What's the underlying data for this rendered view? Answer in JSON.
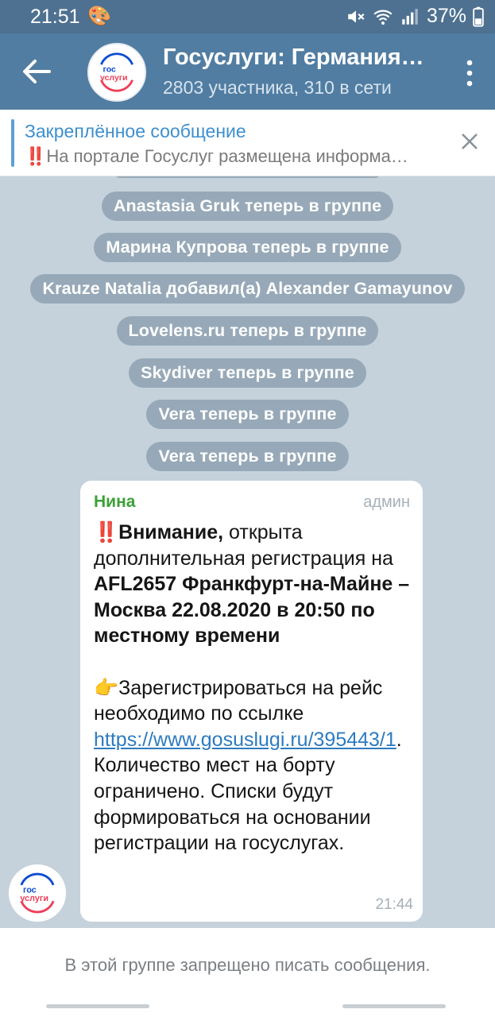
{
  "status_bar": {
    "time": "21:51",
    "battery": "37%",
    "icons": [
      "palette-icon",
      "mute-icon",
      "wifi-icon",
      "signal-icon",
      "battery-icon"
    ]
  },
  "header": {
    "title": "Госуслуги: Германия…",
    "subtitle": "2803 участника, 310 в сети",
    "avatar_text_top": "гос",
    "avatar_text_bottom": "услуги"
  },
  "pinned": {
    "title": "Закреплённое сообщение",
    "text": "‼️На портале Госуслуг размещена информа…"
  },
  "service_messages": [
    "Anastasia Gruk теперь в группе",
    "Марина Купрова теперь в группе",
    "Krauze Natalia добавил(а) Alexander Gamayunov",
    "Lovelens.ru теперь в группе",
    "Skydiver теперь в группе",
    "Vera теперь в группе",
    "Vera теперь в группе"
  ],
  "message": {
    "sender": "Нина",
    "role": "админ",
    "emoji1": "‼️",
    "bold1": "Внимание,",
    "text1": " открыта дополнительная регистрация на ",
    "bold2": "AFL2657 Франкфурт-на-Майне – Москва 22.08.2020  в 20:50 по местному времени",
    "emoji2": "👉",
    "text2": "Зарегистрироваться на рейс необходимо по ссылке ",
    "link": "https://www.gosuslugi.ru/395443/1",
    "text3": ". Количество мест на борту ограничено. Списки будут формироваться на основании регистрации на госуслугах.",
    "time": "21:44"
  },
  "footer": {
    "note": "В этой группе запрещено писать сообщения."
  },
  "colors": {
    "header": "#517da2",
    "status_bar": "#4e7191",
    "sender_name": "#3ca136",
    "link": "#2d7bc0",
    "logo_blue": "#0d4cd3",
    "logo_red": "#ee3f58"
  }
}
